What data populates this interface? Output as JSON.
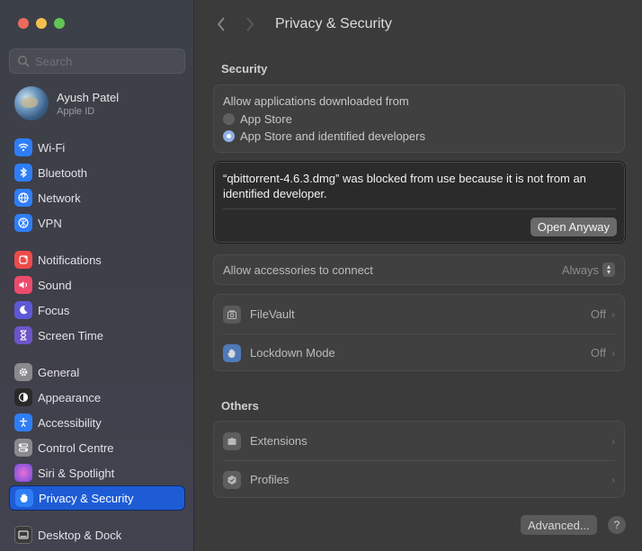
{
  "window": {
    "title": "Privacy & Security"
  },
  "search": {
    "placeholder": "Search"
  },
  "profile": {
    "name": "Ayush Patel",
    "subtitle": "Apple ID"
  },
  "sidebar": {
    "groups": [
      [
        {
          "label": "Wi-Fi",
          "icon": "wifi-icon",
          "color": "#2f7ef6"
        },
        {
          "label": "Bluetooth",
          "icon": "bluetooth-icon",
          "color": "#2f7ef6"
        },
        {
          "label": "Network",
          "icon": "globe-icon",
          "color": "#2f7ef6"
        },
        {
          "label": "VPN",
          "icon": "vpn-icon",
          "color": "#2f7ef6"
        }
      ],
      [
        {
          "label": "Notifications",
          "icon": "bell-icon",
          "color": "#ec4b4b"
        },
        {
          "label": "Sound",
          "icon": "speaker-icon",
          "color": "#ec4b6c"
        },
        {
          "label": "Focus",
          "icon": "moon-icon",
          "color": "#5f58d6"
        },
        {
          "label": "Screen Time",
          "icon": "hourglass-icon",
          "color": "#6b55c9"
        }
      ],
      [
        {
          "label": "General",
          "icon": "gear-icon",
          "color": "#8a8a8e"
        },
        {
          "label": "Appearance",
          "icon": "appearance-icon",
          "color": "#2a2a2a"
        },
        {
          "label": "Accessibility",
          "icon": "accessibility-icon",
          "color": "#2f7ef6"
        },
        {
          "label": "Control Centre",
          "icon": "control-centre-icon",
          "color": "#8a8a8e"
        },
        {
          "label": "Siri & Spotlight",
          "icon": "siri-icon",
          "color": "#b44fd8"
        },
        {
          "label": "Privacy & Security",
          "icon": "hand-icon",
          "color": "#2f7ef6",
          "selected": true
        }
      ],
      [
        {
          "label": "Desktop & Dock",
          "icon": "dock-icon",
          "color": "#3a3a3a"
        }
      ]
    ]
  },
  "main": {
    "security_title": "Security",
    "allow_label": "Allow applications downloaded from",
    "radio_app_store": "App Store",
    "radio_identified": "App Store and identified developers",
    "blocked_message": "“qbittorrent-4.6.3.dmg” was blocked from use because it is not from an identified developer.",
    "open_anyway": "Open Anyway",
    "accessories_label": "Allow accessories to connect",
    "accessories_value": "Always",
    "filevault_label": "FileVault",
    "filevault_value": "Off",
    "lockdown_label": "Lockdown Mode",
    "lockdown_value": "Off",
    "others_title": "Others",
    "extensions_label": "Extensions",
    "profiles_label": "Profiles",
    "advanced": "Advanced...",
    "help": "?"
  }
}
